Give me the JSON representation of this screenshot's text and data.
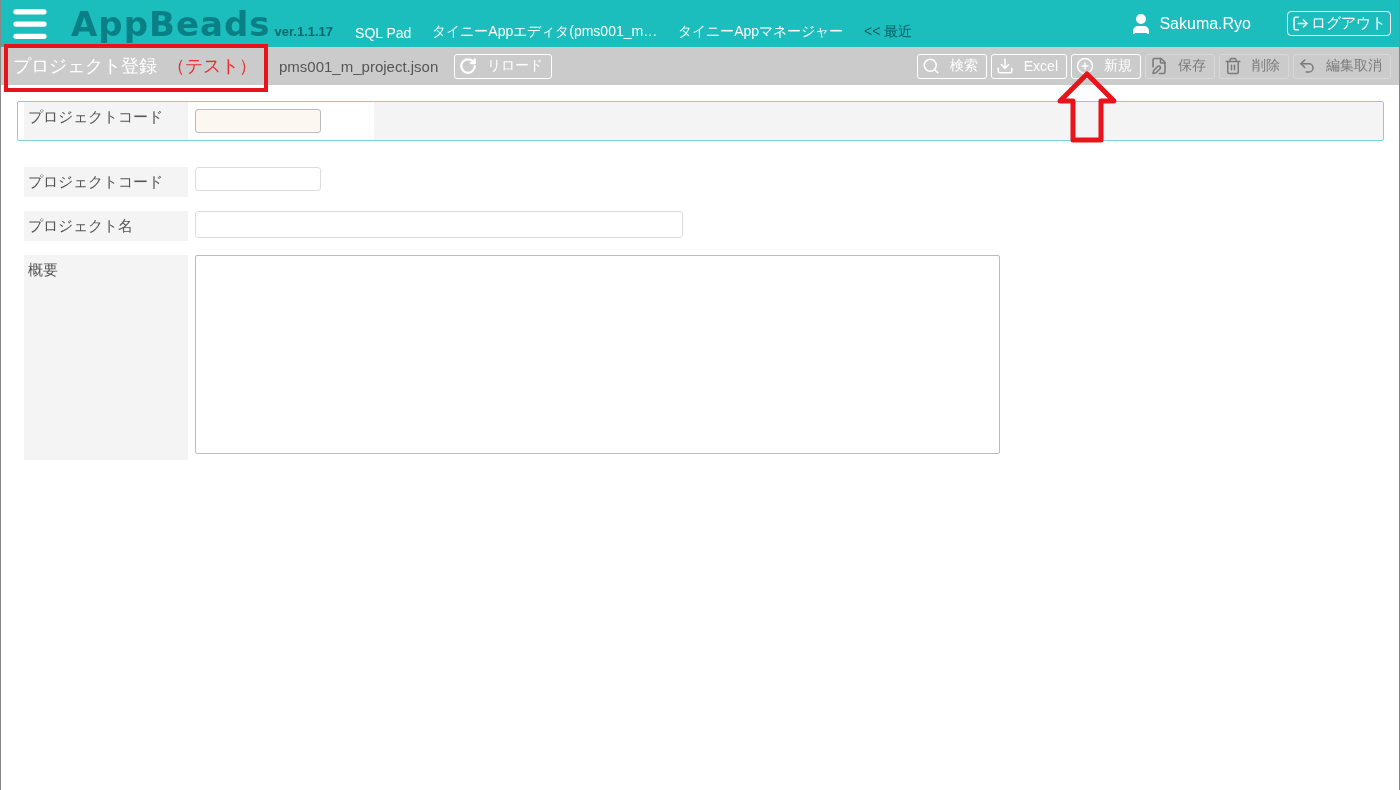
{
  "header": {
    "logo": "AppBeads",
    "version": "ver.1.1.17",
    "nav": [
      {
        "label": "SQL Pad",
        "kind": "link"
      },
      {
        "label": "タイニーAppエディタ(pms001_m…",
        "kind": "link"
      },
      {
        "label": "タイニーAppマネージャー",
        "kind": "link"
      },
      {
        "label": "<< 最近",
        "kind": "recent"
      }
    ],
    "user": "Sakuma.Ryo",
    "logout": "ログアウト"
  },
  "toolbar": {
    "title": "プロジェクト登録",
    "title_suffix": "（テスト）",
    "file": "pms001_m_project.json",
    "reload": "リロード",
    "actions": [
      {
        "label": "検索",
        "disabled": false
      },
      {
        "label": "Excel",
        "disabled": false
      },
      {
        "label": "新規",
        "disabled": false
      },
      {
        "label": "保存",
        "disabled": true
      },
      {
        "label": "削除",
        "disabled": true
      },
      {
        "label": "編集取消",
        "disabled": true
      }
    ]
  },
  "search_panel": {
    "fields": [
      {
        "label": "プロジェクトコード"
      }
    ]
  },
  "form": {
    "fields": [
      {
        "label": "プロジェクトコード",
        "kind": "short"
      },
      {
        "label": "プロジェクト名",
        "kind": "long"
      },
      {
        "label": "概要",
        "kind": "textarea"
      }
    ]
  },
  "annotations": {
    "title_frame": true,
    "new_button_arrow": true
  }
}
